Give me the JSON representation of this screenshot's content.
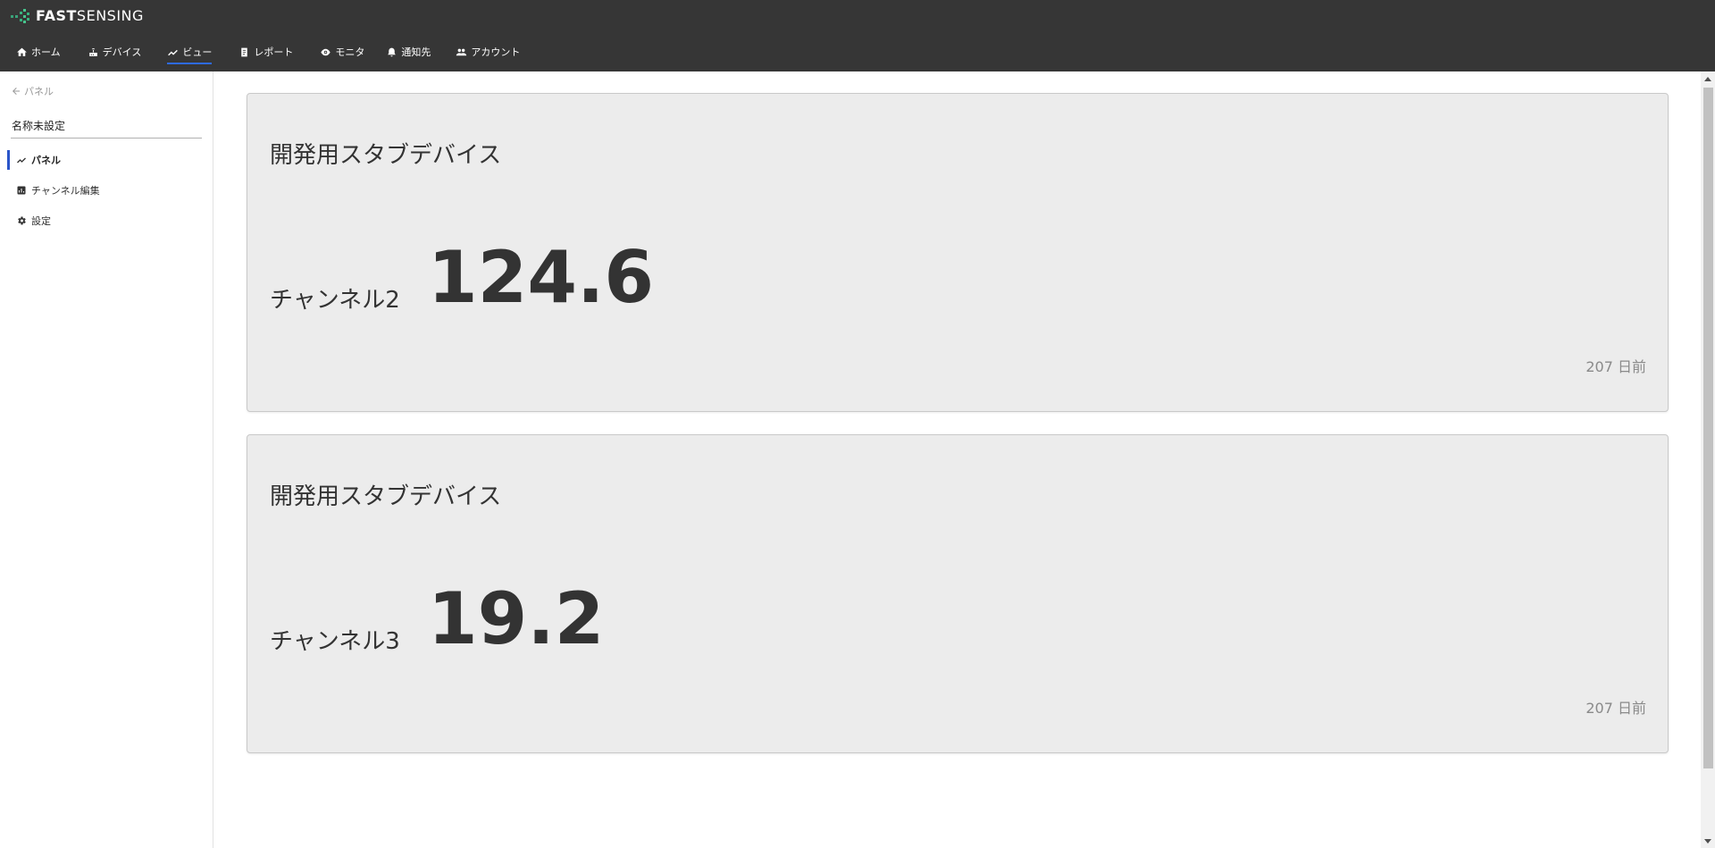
{
  "app": {
    "brand_bold": "FAST",
    "brand_rest": "SENSING"
  },
  "nav": [
    {
      "label": "ホーム",
      "icon": "home-icon",
      "active": false
    },
    {
      "label": "デバイス",
      "icon": "router-icon",
      "active": false
    },
    {
      "label": "ビュー",
      "icon": "trend-icon",
      "active": true
    },
    {
      "label": "レポート",
      "icon": "clipboard-icon",
      "active": false
    },
    {
      "label": "モニタ",
      "icon": "eye-icon",
      "active": false
    },
    {
      "label": "通知先",
      "icon": "bell-icon",
      "active": false
    },
    {
      "label": "アカウント",
      "icon": "people-icon",
      "active": false
    }
  ],
  "sidebar": {
    "back_label": "パネル",
    "view_title": "名称未設定",
    "items": [
      {
        "label": "パネル",
        "icon": "trend-icon",
        "active": true
      },
      {
        "label": "チャンネル編集",
        "icon": "chart-box-icon",
        "active": false
      },
      {
        "label": "設定",
        "icon": "gear-icon",
        "active": false
      }
    ]
  },
  "panels": [
    {
      "title": "開発用スタブデバイス",
      "channel": "チャンネル2",
      "value": "124.6",
      "ago": "207 日前"
    },
    {
      "title": "開発用スタブデバイス",
      "channel": "チャンネル3",
      "value": "19.2",
      "ago": "207 日前"
    }
  ],
  "colors": {
    "topbar": "#363636",
    "accent": "#2e6ae6",
    "panel_bg": "#ececec",
    "brand_green": "#36b37e"
  }
}
